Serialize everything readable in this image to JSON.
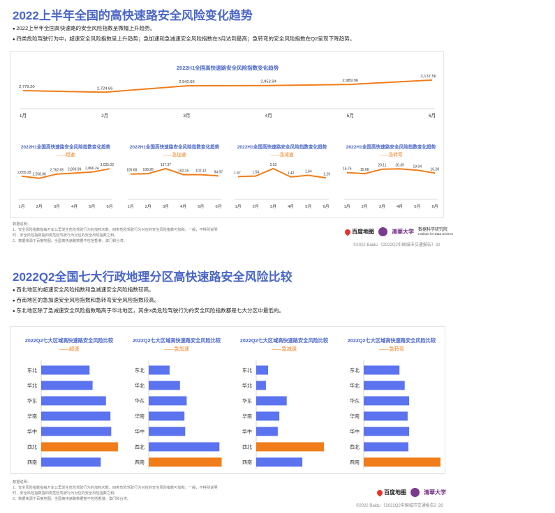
{
  "top": {
    "title": "2022上半年全国的高快速路安全风险变化趋势",
    "bullets": [
      "2022上半年全国高快速路的安全风险指数呈微幅上升趋势。",
      "四类危险驾驶行为中，超速安全风险指数呈上升趋势；急加速和急减速安全风险指数在3月达到最高；急转弯的安全风险指数在Q2呈现下降趋势。"
    ],
    "notes": [
      "数据说明：",
      "1、安全风险指数指每万车公里发生危险驾驶行为的加权次数。四类危险驾驶行为对应的安全风险指数可加和，一般，不特别说明",
      "   时，安全风险指数指四类危险驾驶行为对应的安全风险指数之和。",
      "2、数据来源于百度地图。全国高快速路数据不包括香港、澳门和台湾。"
    ],
    "footer": "©2022 Baidu 《2022Q2中国城市交通报告》32"
  },
  "bottom": {
    "title": "2022Q2全国七大行政地理分区高快速路安全风险比较",
    "bullets": [
      "西北地区的超速安全风险指数和急减速安全风险指数较高。",
      "西南地区的急加速安全风险指数和急转弯安全风险指数较高。",
      "东北地区除了急减速安全风险指数略高于华北地区，其余3类危险驾驶行为的安全风险指数都是七大分区中最低的。"
    ],
    "notes": [
      "数据说明：",
      "1、安全风险指数指每万车公里发生危险驾驶行为的加权次数。四类危险驾驶行为对应的安全风险指数可加和，一般，不特别说明",
      "   时，安全风险指数指四类危险驾驶行为对应的安全风险指数之和。",
      "2、数据来源于百度地图。全国高快速路数据暂不包括香港、澳门和台湾。"
    ],
    "footer": "©2022 Baidu 《2022Q2中国城市交通报告》26"
  },
  "logos": {
    "baidu": "百度地图",
    "tsinghua": "清華大学",
    "dsi": "数据科学研究院",
    "dsi_en": "Institute for Data Science"
  },
  "colors": {
    "orange": "#f07d1a",
    "blue": "#5b73ef",
    "title": "#4a66c8"
  },
  "chart_data": [
    {
      "type": "line",
      "title": "2022H1全国高快速路安全风险指数变化趋势",
      "x": [
        "1月",
        "2月",
        "3月",
        "4月",
        "5月",
        "6月"
      ],
      "values": [
        2779.2,
        2724.66,
        2942.66,
        2952.94,
        2989.06,
        3137.56
      ],
      "labels": [
        "2,779.20",
        "2,724.66",
        "2,942.66",
        "2,952.94",
        "2,989.06",
        "3,137.56"
      ],
      "ylim": [
        2400,
        3300
      ]
    },
    {
      "type": "line",
      "title": "2022H1全国高快速路安全风险指数变化趋势",
      "subtitle": "——超速",
      "x": [
        "1月",
        "2月",
        "3月",
        "4月",
        "5月",
        "6月"
      ],
      "values": [
        2655.29,
        2558.06,
        2762.65,
        2809.99,
        2866.24,
        3025.02
      ],
      "labels": [
        "2,655.29",
        "2,558.06",
        "2,762.65",
        "2,809.99",
        "2,866.24",
        "3,025.02"
      ],
      "ylim": [
        2200,
        3100
      ]
    },
    {
      "type": "line",
      "title": "2022H1全国高快速路安全风险指数变化趋势",
      "subtitle": "——急加速",
      "x": [
        "1月",
        "2月",
        "3月",
        "4月",
        "5月",
        "6月"
      ],
      "values": [
        105.68,
        108.26,
        137.37,
        102.15,
        102.12,
        94.97
      ],
      "labels": [
        "105.68",
        "108.26",
        "137.37",
        "102.15",
        "102.12",
        "94.97"
      ],
      "ylim": [
        40,
        145
      ]
    },
    {
      "type": "line",
      "title": "2022H1全国高快速路安全风险指数变化趋势",
      "subtitle": "——急减速",
      "x": [
        "1月",
        "2月",
        "3月",
        "4月",
        "5月",
        "6月"
      ],
      "values": [
        1.47,
        1.54,
        2.53,
        1.42,
        1.64,
        1.29
      ],
      "labels": [
        "1.47",
        "1.54",
        "2.53",
        "1.42",
        "1.64",
        "1.29"
      ],
      "ylim": [
        0.3,
        2.7
      ]
    },
    {
      "type": "line",
      "title": "2022H1全国高快速路安全风险指数变化趋势",
      "subtitle": "——急转弯",
      "x": [
        "1月",
        "2月",
        "3月",
        "4月",
        "5月",
        "6月"
      ],
      "values": [
        16.75,
        15.66,
        20.11,
        20.39,
        19.04,
        16.28
      ],
      "labels": [
        "16.75",
        "15.66",
        "20.11",
        "20.39",
        "19.04",
        "16.28"
      ],
      "ylim": [
        4,
        22
      ]
    },
    {
      "type": "bar",
      "title": "2022Q2七大区域高快速路安全风险比较",
      "subtitle": "——超速",
      "categories": [
        "东北",
        "华北",
        "华东",
        "华南",
        "华中",
        "西北",
        "西南"
      ],
      "values": [
        65,
        69,
        87,
        93,
        94,
        103,
        80
      ],
      "highlight": [
        "西北"
      ]
    },
    {
      "type": "bar",
      "title": "2022Q2七大区域高快速路安全风险比较",
      "subtitle": "——急加速",
      "categories": [
        "东北",
        "华北",
        "华东",
        "华南",
        "华中",
        "西北",
        "西南"
      ],
      "values": [
        28,
        42,
        51,
        48,
        49,
        95,
        98
      ],
      "highlight": [
        "西南"
      ]
    },
    {
      "type": "bar",
      "title": "2022Q2七大区域高快速路安全风险比较",
      "subtitle": "——急减速",
      "categories": [
        "东北",
        "华北",
        "华东",
        "华南",
        "华中",
        "西北",
        "西南"
      ],
      "values": [
        16,
        13,
        41,
        31,
        29,
        91,
        62
      ],
      "highlight": [
        "西北"
      ]
    },
    {
      "type": "bar",
      "title": "2022Q2七大区域高快速路安全风险比较",
      "subtitle": "——急转弯",
      "categories": [
        "东北",
        "华北",
        "华东",
        "华南",
        "华中",
        "西北",
        "西南"
      ],
      "values": [
        48,
        55,
        61,
        59,
        61,
        60,
        103
      ],
      "highlight": [
        "西南"
      ]
    }
  ]
}
